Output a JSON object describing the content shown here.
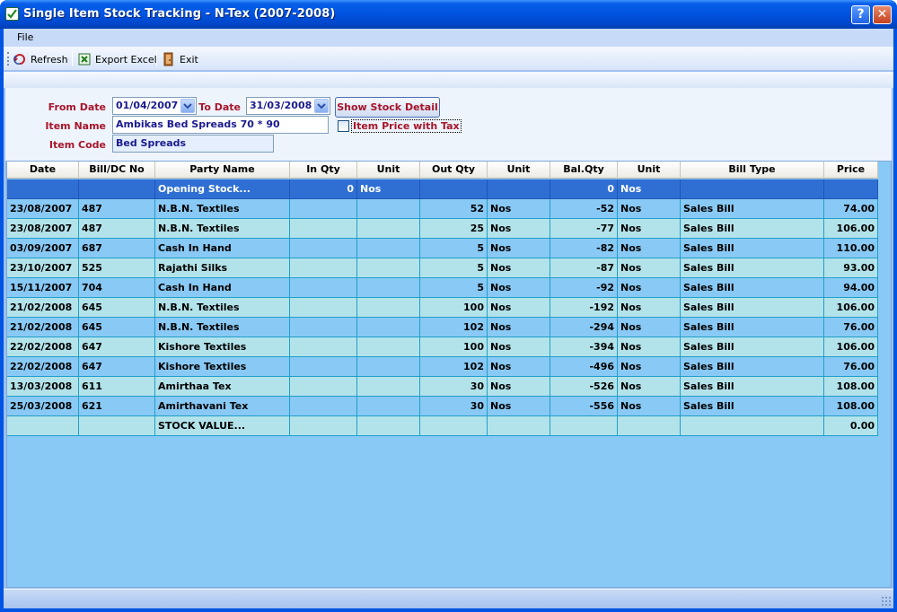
{
  "window": {
    "title": "Single Item Stock Tracking - N-Tex (2007-2008)",
    "help_label": "?",
    "close_label": "✕"
  },
  "menu": {
    "file_label": "File"
  },
  "toolbar": {
    "refresh_label": "Refresh",
    "export_label": "Export Excel",
    "exit_label": "Exit"
  },
  "form": {
    "from_date_label": "From Date",
    "from_date_value": "01/04/2007",
    "to_date_label": "To Date",
    "to_date_value": "31/03/2008",
    "show_button_label": "Show Stock Detail",
    "item_name_label": "Item Name",
    "item_name_value": "Ambikas Bed Spreads 70 * 90",
    "item_price_tax_label": "Item Price with Tax",
    "item_price_tax_checked": false,
    "item_code_label": "Item Code",
    "item_code_value": "Bed Spreads"
  },
  "grid": {
    "columns": [
      "Date",
      "Bill/DC No",
      "Party Name",
      "In Qty",
      "Unit",
      "Out Qty",
      "Unit",
      "Bal.Qty",
      "Unit",
      "Bill Type",
      "Price"
    ],
    "rows": [
      [
        "",
        "",
        "Opening Stock...",
        "0",
        "Nos",
        "",
        "",
        "0",
        "Nos",
        "",
        ""
      ],
      [
        "23/08/2007",
        "487",
        "N.B.N. Textiles",
        "",
        "",
        "52",
        "Nos",
        "-52",
        "Nos",
        "Sales Bill",
        "74.00"
      ],
      [
        "23/08/2007",
        "487",
        "N.B.N. Textiles",
        "",
        "",
        "25",
        "Nos",
        "-77",
        "Nos",
        "Sales Bill",
        "106.00"
      ],
      [
        "03/09/2007",
        "687",
        "Cash In Hand",
        "",
        "",
        "5",
        "Nos",
        "-82",
        "Nos",
        "Sales Bill",
        "110.00"
      ],
      [
        "23/10/2007",
        "525",
        "Rajathi Silks",
        "",
        "",
        "5",
        "Nos",
        "-87",
        "Nos",
        "Sales Bill",
        "93.00"
      ],
      [
        "15/11/2007",
        "704",
        "Cash In Hand",
        "",
        "",
        "5",
        "Nos",
        "-92",
        "Nos",
        "Sales Bill",
        "94.00"
      ],
      [
        "21/02/2008",
        "645",
        "N.B.N. Textiles",
        "",
        "",
        "100",
        "Nos",
        "-192",
        "Nos",
        "Sales Bill",
        "106.00"
      ],
      [
        "21/02/2008",
        "645",
        "N.B.N. Textiles",
        "",
        "",
        "102",
        "Nos",
        "-294",
        "Nos",
        "Sales Bill",
        "76.00"
      ],
      [
        "22/02/2008",
        "647",
        "Kishore Textiles",
        "",
        "",
        "100",
        "Nos",
        "-394",
        "Nos",
        "Sales Bill",
        "106.00"
      ],
      [
        "22/02/2008",
        "647",
        "Kishore Textiles",
        "",
        "",
        "102",
        "Nos",
        "-496",
        "Nos",
        "Sales Bill",
        "76.00"
      ],
      [
        "13/03/2008",
        "611",
        "Amirthaa Tex",
        "",
        "",
        "30",
        "Nos",
        "-526",
        "Nos",
        "Sales Bill",
        "108.00"
      ],
      [
        "25/03/2008",
        "621",
        "Amirthavani Tex",
        "",
        "",
        "30",
        "Nos",
        "-556",
        "Nos",
        "Sales Bill",
        "108.00"
      ],
      [
        "",
        "",
        "STOCK VALUE...",
        "",
        "",
        "",
        "",
        "",
        "",
        "",
        "0.00"
      ]
    ],
    "selected_row": 0
  },
  "colors": {
    "title_bar": "#0054e3",
    "label_text": "#a8152a",
    "field_text": "#1b1b8f",
    "row_odd": "#89c9f5",
    "row_even": "#b3e3ea",
    "row_selected": "#2f6fd3"
  },
  "icons": {
    "app": "checkmark-app-icon",
    "refresh": "refresh-icon",
    "export": "excel-icon",
    "exit": "exit-door-icon",
    "dropdown": "chevron-down-icon"
  }
}
